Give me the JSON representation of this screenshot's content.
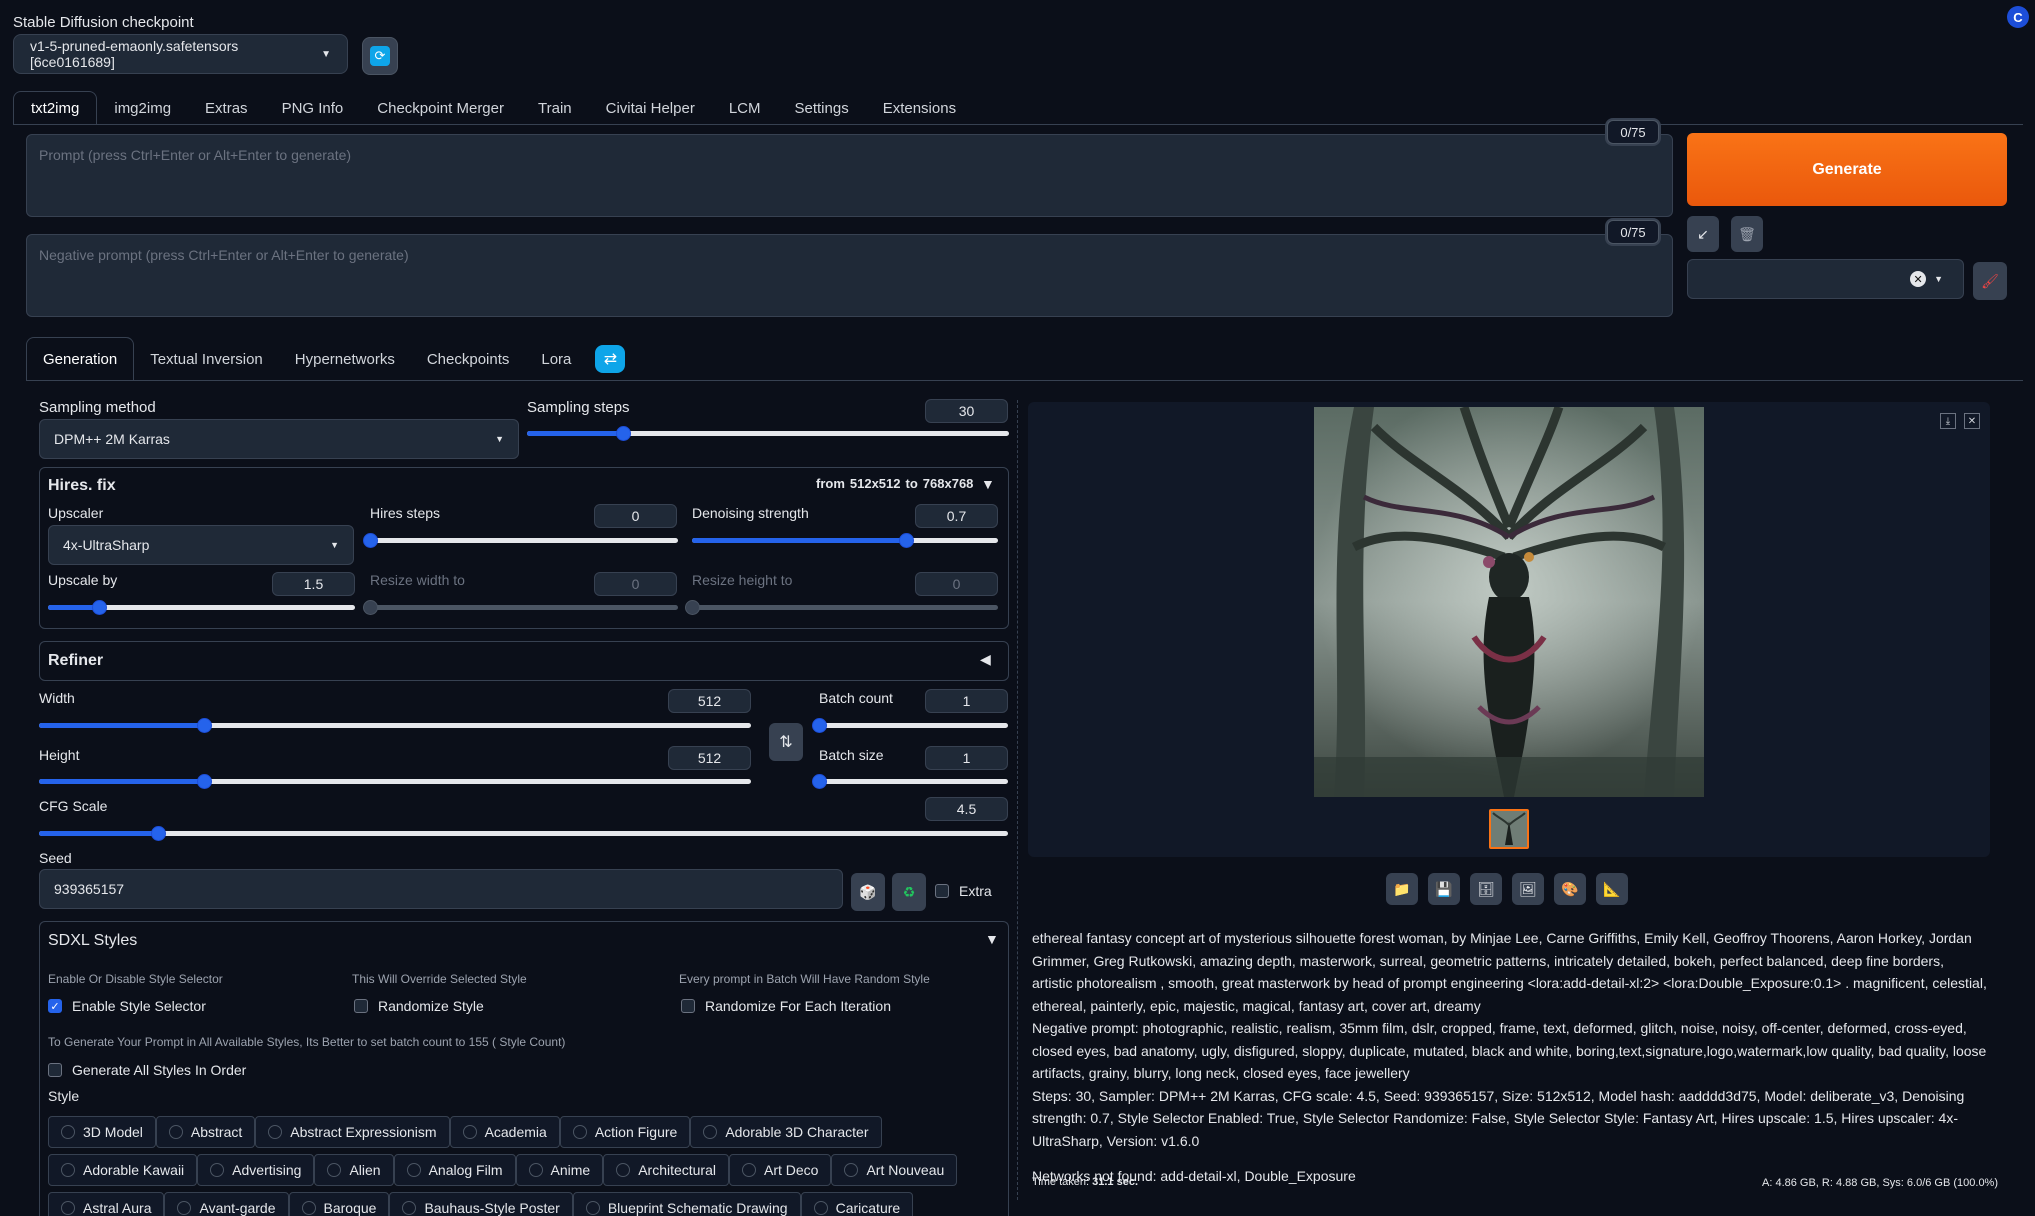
{
  "checkpoint": {
    "label": "Stable Diffusion checkpoint",
    "value": "v1-5-pruned-emaonly.safetensors [6ce0161689]"
  },
  "main_tabs": [
    "txt2img",
    "img2img",
    "Extras",
    "PNG Info",
    "Checkpoint Merger",
    "Train",
    "Civitai Helper",
    "LCM",
    "Settings",
    "Extensions"
  ],
  "prompt": {
    "placeholder": "Prompt (press Ctrl+Enter or Alt+Enter to generate)",
    "counter": "0/75"
  },
  "negative_prompt": {
    "placeholder": "Negative prompt (press Ctrl+Enter or Alt+Enter to generate)",
    "counter": "0/75"
  },
  "generate_label": "Generate",
  "sub_tabs": [
    "Generation",
    "Textual Inversion",
    "Hypernetworks",
    "Checkpoints",
    "Lora"
  ],
  "sampling": {
    "method_label": "Sampling method",
    "method_value": "DPM++ 2M Karras",
    "steps_label": "Sampling steps",
    "steps_value": "30",
    "steps_fraction": 0.2
  },
  "hires": {
    "title": "Hires. fix",
    "from_text": "from",
    "from_size": "512x512",
    "to_text": "to",
    "to_size": "768x768",
    "upscaler_label": "Upscaler",
    "upscaler_value": "4x-UltraSharp",
    "steps_label": "Hires steps",
    "steps_value": "0",
    "denoise_label": "Denoising strength",
    "denoise_value": "0.7",
    "upscale_by_label": "Upscale by",
    "upscale_by_value": "1.5",
    "resize_w_label": "Resize width to",
    "resize_w_value": "0",
    "resize_h_label": "Resize height to",
    "resize_h_value": "0"
  },
  "refiner_title": "Refiner",
  "dimensions": {
    "width_label": "Width",
    "width_value": "512",
    "height_label": "Height",
    "height_value": "512",
    "batch_count_label": "Batch count",
    "batch_count_value": "1",
    "batch_size_label": "Batch size",
    "batch_size_value": "1",
    "cfg_label": "CFG Scale",
    "cfg_value": "4.5"
  },
  "seed": {
    "label": "Seed",
    "value": "939365157",
    "extra_label": "Extra"
  },
  "sdxl": {
    "title": "SDXL Styles",
    "hint1": "Enable Or Disable Style Selector",
    "hint2": "This Will Override Selected Style",
    "hint3": "Every prompt in Batch Will Have Random Style",
    "enable_label": "Enable Style Selector",
    "randomize_label": "Randomize Style",
    "randomize_each_label": "Randomize For Each Iteration",
    "note": "To Generate Your Prompt in All Available Styles, Its Better to set batch count to 155 ( Style Count)",
    "generate_all_label": "Generate All Styles In Order",
    "style_label": "Style",
    "row1": [
      "3D Model",
      "Abstract",
      "Abstract Expressionism",
      "Academia",
      "Action Figure",
      "Adorable 3D Character"
    ],
    "row2": [
      "Adorable Kawaii",
      "Advertising",
      "Alien",
      "Analog Film",
      "Anime",
      "Architectural",
      "Art Deco",
      "Art Nouveau"
    ],
    "row3": [
      "Astral Aura",
      "Avant-garde",
      "Baroque",
      "Bauhaus-Style Poster",
      "Blueprint Schematic Drawing",
      "Caricature"
    ]
  },
  "output": {
    "info_prompt": "ethereal fantasy concept art of mysterious silhouette forest woman, by Minjae Lee, Carne Griffiths, Emily Kell, Geoffroy Thoorens, Aaron Horkey, Jordan Grimmer, Greg Rutkowski, amazing depth, masterwork, surreal, geometric patterns, intricately detailed, bokeh, perfect balanced, deep fine borders, artistic photorealism , smooth, great masterwork by head of prompt engineering <lora:add-detail-xl:2> <lora:Double_Exposure:0.1> . magnificent, celestial, ethereal, painterly, epic, majestic, magical, fantasy art, cover art, dreamy",
    "info_negative": "Negative prompt: photographic, realistic, realism, 35mm film, dslr, cropped, frame, text, deformed, glitch, noise, noisy, off-center, deformed, cross-eyed, closed eyes, bad anatomy, ugly, disfigured, sloppy, duplicate, mutated, black and white, boring,text,signature,logo,watermark,low quality, bad quality, loose artifacts, grainy, blurry, long neck, closed eyes, face jewellery",
    "info_params": "Steps: 30, Sampler: DPM++ 2M Karras, CFG scale: 4.5, Seed: 939365157, Size: 512x512, Model hash: aadddd3d75, Model: deliberate_v3, Denoising strength: 0.7, Style Selector Enabled: True, Style Selector Randomize: False, Style Selector Style: Fantasy Art, Hires upscale: 1.5, Hires upscaler: 4x-UltraSharp, Version: v1.6.0",
    "networks": "Networks not found: add-detail-xl, Double_Exposure",
    "time_label": "Time taken:",
    "time_value": "31.1 sec.",
    "vram": "A: 4.86 GB, R: 4.88 GB, Sys: 6.0/6 GB (100.0%)"
  },
  "colors": {
    "accent": "#2563eb",
    "generate": "#f97316",
    "background": "#0b0f19"
  }
}
